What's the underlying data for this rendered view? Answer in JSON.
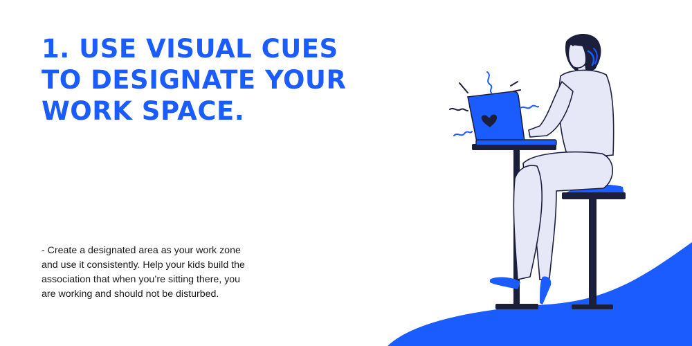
{
  "heading": {
    "line1": "1. USE VISUAL CUES",
    "line2": "TO DESIGNATE YOUR",
    "line3": "WORK SPACE."
  },
  "body": {
    "text": "- Create a designated area as your work zone and use it consistently. Help your kids build the association that when you’re sitting there, you are working and should not be disturbed."
  },
  "colors": {
    "accent": "#1a5cff",
    "navy": "#1b1f3b",
    "figure": "#e6e8f8",
    "text": "#1a1a1a",
    "background": "#ffffff"
  }
}
